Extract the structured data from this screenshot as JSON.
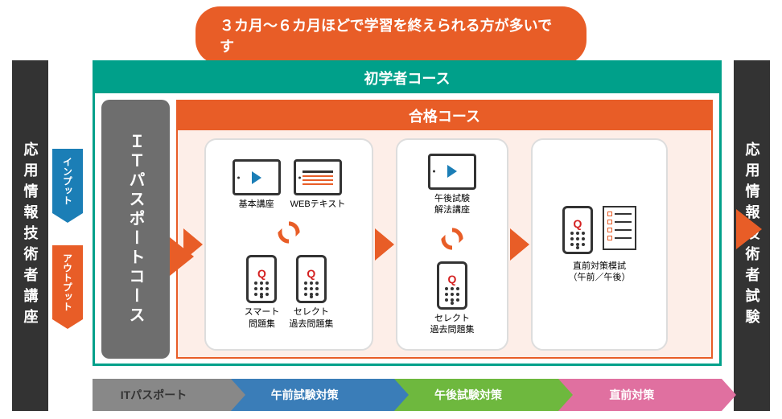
{
  "banner": "３カ月〜６カ月ほどで学習を終えられる方が多いです",
  "left_label": "応用情報技術者講座",
  "right_label": "応用情報技術者試験",
  "tags": {
    "input": "インプット",
    "output": "アウトプット"
  },
  "beginner_course": {
    "title": "初学者コース",
    "it_passport": "ＩＴパスポートコース"
  },
  "pass_course": {
    "title": "合格コース",
    "stage1": {
      "items": [
        "基本講座",
        "WEBテキスト",
        "スマート\n問題集",
        "セレクト\n過去問題集"
      ]
    },
    "stage2": {
      "items": [
        "午後試験\n解法講座",
        "セレクト\n過去問題集"
      ]
    },
    "stage3": {
      "label": "直前対策模試\n（午前／午後）"
    }
  },
  "bottom_flow": [
    "ITパスポート",
    "午前試験対策",
    "午後試験対策",
    "直前対策"
  ]
}
